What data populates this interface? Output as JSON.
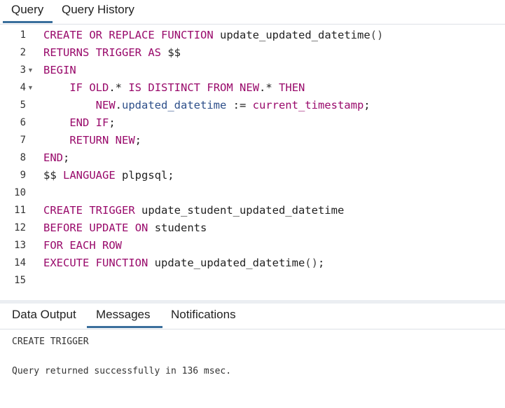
{
  "top_tabs": [
    {
      "label": "Query",
      "active": true
    },
    {
      "label": "Query History",
      "active": false
    }
  ],
  "editor": {
    "lines": [
      {
        "num": "1",
        "fold": "",
        "tokens": [
          {
            "t": "CREATE",
            "c": "kw"
          },
          {
            "t": " ",
            "c": "pl"
          },
          {
            "t": "OR",
            "c": "kw"
          },
          {
            "t": " ",
            "c": "pl"
          },
          {
            "t": "REPLACE",
            "c": "kw"
          },
          {
            "t": " ",
            "c": "pl"
          },
          {
            "t": "FUNCTION",
            "c": "kw"
          },
          {
            "t": " update_updated_datetime",
            "c": "pl"
          },
          {
            "t": "()",
            "c": "pn"
          }
        ]
      },
      {
        "num": "2",
        "fold": "",
        "tokens": [
          {
            "t": "RETURNS",
            "c": "kw"
          },
          {
            "t": " ",
            "c": "pl"
          },
          {
            "t": "TRIGGER",
            "c": "kw"
          },
          {
            "t": " ",
            "c": "pl"
          },
          {
            "t": "AS",
            "c": "kw"
          },
          {
            "t": " $$",
            "c": "pl"
          }
        ]
      },
      {
        "num": "3",
        "fold": "▼",
        "tokens": [
          {
            "t": "BEGIN",
            "c": "kw"
          }
        ]
      },
      {
        "num": "4",
        "fold": "▼",
        "tokens": [
          {
            "t": "    ",
            "c": "pl"
          },
          {
            "t": "IF",
            "c": "kw"
          },
          {
            "t": " ",
            "c": "pl"
          },
          {
            "t": "OLD",
            "c": "kw"
          },
          {
            "t": ".* ",
            "c": "pl"
          },
          {
            "t": "IS",
            "c": "kw"
          },
          {
            "t": " ",
            "c": "pl"
          },
          {
            "t": "DISTINCT",
            "c": "kw"
          },
          {
            "t": " ",
            "c": "pl"
          },
          {
            "t": "FROM",
            "c": "kw"
          },
          {
            "t": " ",
            "c": "pl"
          },
          {
            "t": "NEW",
            "c": "kw"
          },
          {
            "t": ".* ",
            "c": "pl"
          },
          {
            "t": "THEN",
            "c": "kw"
          }
        ]
      },
      {
        "num": "5",
        "fold": "",
        "tokens": [
          {
            "t": "        ",
            "c": "pl"
          },
          {
            "t": "NEW",
            "c": "kw"
          },
          {
            "t": ".",
            "c": "pl"
          },
          {
            "t": "updated_datetime",
            "c": "id"
          },
          {
            "t": " := ",
            "c": "pl"
          },
          {
            "t": "current_timestamp",
            "c": "kw"
          },
          {
            "t": ";",
            "c": "pl"
          }
        ]
      },
      {
        "num": "6",
        "fold": "",
        "tokens": [
          {
            "t": "    ",
            "c": "pl"
          },
          {
            "t": "END",
            "c": "kw"
          },
          {
            "t": " ",
            "c": "pl"
          },
          {
            "t": "IF",
            "c": "kw"
          },
          {
            "t": ";",
            "c": "pl"
          }
        ]
      },
      {
        "num": "7",
        "fold": "",
        "tokens": [
          {
            "t": "    ",
            "c": "pl"
          },
          {
            "t": "RETURN",
            "c": "kw"
          },
          {
            "t": " ",
            "c": "pl"
          },
          {
            "t": "NEW",
            "c": "kw"
          },
          {
            "t": ";",
            "c": "pl"
          }
        ]
      },
      {
        "num": "8",
        "fold": "",
        "tokens": [
          {
            "t": "END",
            "c": "kw"
          },
          {
            "t": ";",
            "c": "pl"
          }
        ]
      },
      {
        "num": "9",
        "fold": "",
        "tokens": [
          {
            "t": "$$ ",
            "c": "pl"
          },
          {
            "t": "LANGUAGE",
            "c": "kw"
          },
          {
            "t": " plpgsql;",
            "c": "pl"
          }
        ]
      },
      {
        "num": "10",
        "fold": "",
        "tokens": []
      },
      {
        "num": "11",
        "fold": "",
        "tokens": [
          {
            "t": "CREATE",
            "c": "kw"
          },
          {
            "t": " ",
            "c": "pl"
          },
          {
            "t": "TRIGGER",
            "c": "kw"
          },
          {
            "t": " update_student_updated_datetime",
            "c": "pl"
          }
        ]
      },
      {
        "num": "12",
        "fold": "",
        "tokens": [
          {
            "t": "BEFORE",
            "c": "kw"
          },
          {
            "t": " ",
            "c": "pl"
          },
          {
            "t": "UPDATE",
            "c": "kw"
          },
          {
            "t": " ",
            "c": "pl"
          },
          {
            "t": "ON",
            "c": "kw"
          },
          {
            "t": " students",
            "c": "pl"
          }
        ]
      },
      {
        "num": "13",
        "fold": "",
        "tokens": [
          {
            "t": "FOR",
            "c": "kw"
          },
          {
            "t": " ",
            "c": "pl"
          },
          {
            "t": "EACH",
            "c": "kw"
          },
          {
            "t": " ",
            "c": "pl"
          },
          {
            "t": "ROW",
            "c": "kw"
          }
        ]
      },
      {
        "num": "14",
        "fold": "",
        "tokens": [
          {
            "t": "EXECUTE",
            "c": "kw"
          },
          {
            "t": " ",
            "c": "pl"
          },
          {
            "t": "FUNCTION",
            "c": "kw"
          },
          {
            "t": " update_updated_datetime",
            "c": "pl"
          },
          {
            "t": "()",
            "c": "pn"
          },
          {
            "t": ";",
            "c": "pl"
          }
        ]
      },
      {
        "num": "15",
        "fold": "",
        "tokens": []
      }
    ]
  },
  "bottom_tabs": [
    {
      "label": "Data Output",
      "active": false
    },
    {
      "label": "Messages",
      "active": true
    },
    {
      "label": "Notifications",
      "active": false
    }
  ],
  "messages": [
    "CREATE TRIGGER",
    "",
    "Query returned successfully in 136 msec."
  ],
  "colors": {
    "keyword": "#990a6b",
    "identifier": "#2d4f8a",
    "tab_underline": "#3a6f9c"
  }
}
